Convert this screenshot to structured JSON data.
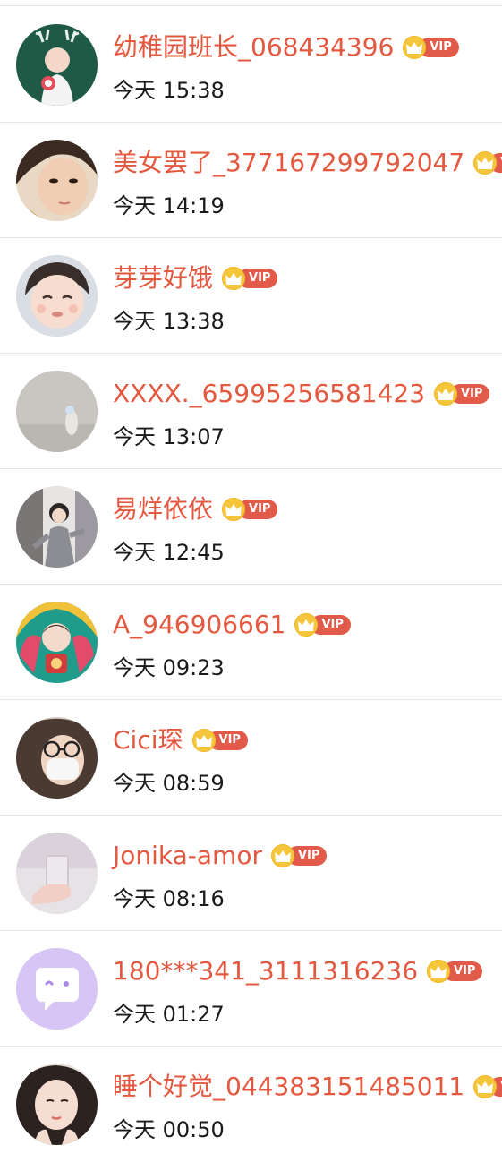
{
  "vip_label": "VIP",
  "colors": {
    "name": "#e4583f",
    "vip_badge": "#e25a4a",
    "crown": "#f5c63b",
    "time": "#1a1a1a"
  },
  "items": [
    {
      "name": "幼稚园班长_068434396",
      "time": "今天 15:38",
      "avatar": "woman-with-antlers"
    },
    {
      "name": "美女罢了_377167299792047",
      "time": "今天 14:19",
      "avatar": "woman-face"
    },
    {
      "name": "芽芽好饿",
      "time": "今天 13:38",
      "avatar": "baby-face"
    },
    {
      "name": "XXXX._65995256581423",
      "time": "今天 13:07",
      "avatar": "grey-figure"
    },
    {
      "name": "易烊依依",
      "time": "今天 12:45",
      "avatar": "person-dancing"
    },
    {
      "name": "A_946906661",
      "time": "今天 09:23",
      "avatar": "cartoon-boy"
    },
    {
      "name": "Cici琛",
      "time": "今天 08:59",
      "avatar": "woman-with-mask"
    },
    {
      "name": "Jonika-amor",
      "time": "今天 08:16",
      "avatar": "hand-with-glass"
    },
    {
      "name": "180***341_3111316236",
      "time": "今天 01:27",
      "avatar": "chat-bubble-icon"
    },
    {
      "name": "睡个好觉_044383151485011",
      "time": "今天 00:50",
      "avatar": "girl-hands"
    }
  ]
}
